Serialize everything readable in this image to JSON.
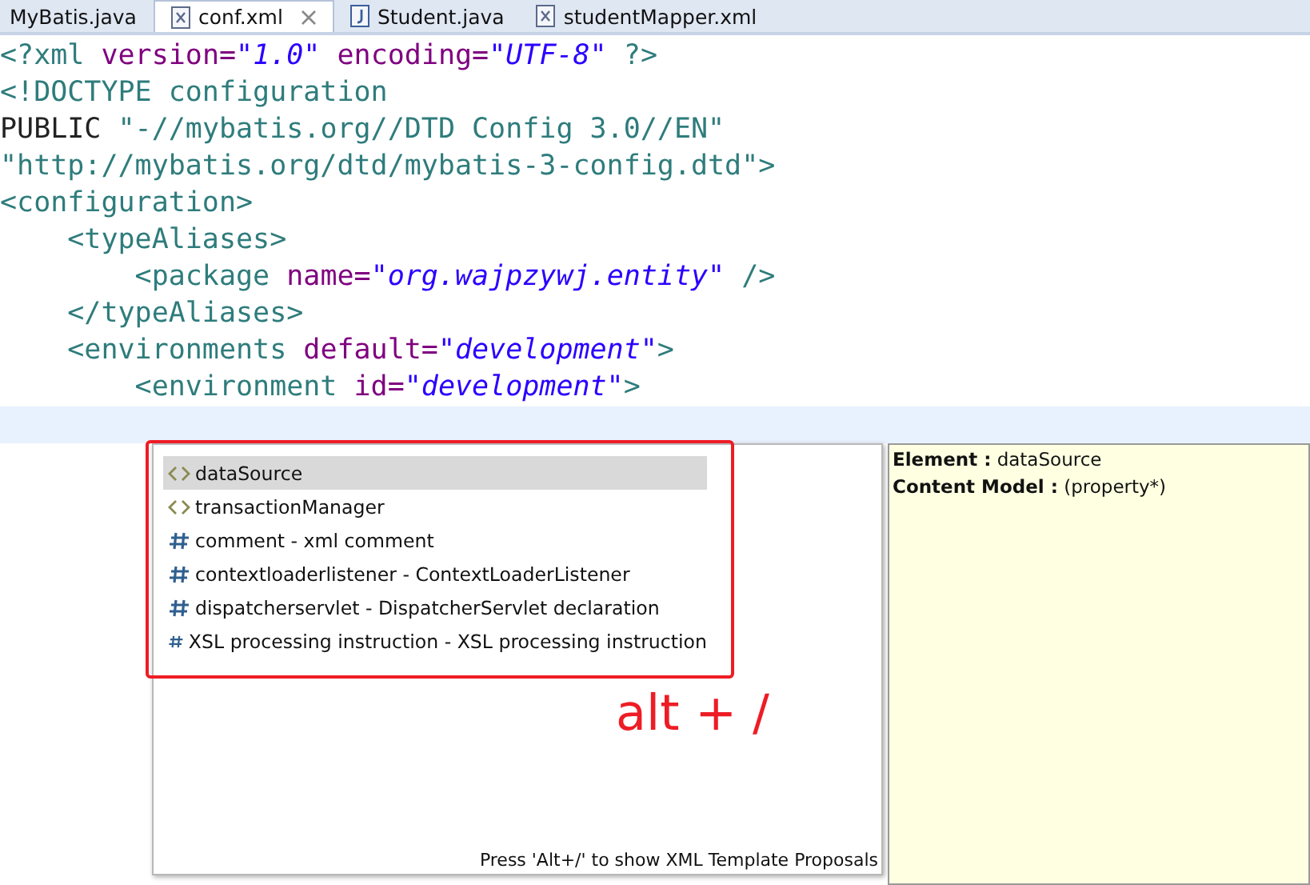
{
  "tabs": [
    {
      "label": "MyBatis.java",
      "kind": "none",
      "selected": false
    },
    {
      "label": "conf.xml",
      "kind": "xml",
      "selected": true
    },
    {
      "label": "Student.java",
      "kind": "java",
      "selected": false
    },
    {
      "label": "studentMapper.xml",
      "kind": "xml",
      "selected": false
    }
  ],
  "code": [
    {
      "kind": "tag",
      "open": "<?xml",
      "attrs": [
        {
          "name": "version=",
          "value": "\"1.0\""
        },
        {
          "name": "encoding=",
          "value": "\"UTF-8\""
        }
      ],
      "close": "?>",
      "current": false
    },
    {
      "kind": "doctype",
      "segments": [
        {
          "kind": "tag",
          "text": "<!DOCTYPE configuration"
        }
      ],
      "current": false
    },
    {
      "kind": "doctype",
      "segments": [
        {
          "kind": "keyword",
          "text": "PUBLIC"
        },
        {
          "kind": "string",
          "text": "\"-//mybatis.org//DTD Config 3.0//EN\""
        }
      ],
      "current": false
    },
    {
      "kind": "doctype",
      "segments": [
        {
          "kind": "string",
          "text": "\"http://mybatis.org/dtd/mybatis-3-config.dtd\""
        },
        {
          "kind": "tag",
          "text": ">"
        }
      ],
      "current": false
    },
    {
      "kind": "tag",
      "open": "<configuration",
      "close": ">",
      "current": false,
      "children": [
        {
          "kind": "tag",
          "open": "<typeAliases",
          "close": ">",
          "current": false,
          "children": [
            {
              "kind": "tag",
              "open": "<package",
              "attrs": [
                {
                  "name": "name=",
                  "value": "\"org.wajpzywj.entity\""
                }
              ],
              "close": "/>",
              "current": false
            }
          ]
        },
        {
          "kind": "tag",
          "open": "</typeAliases",
          "close": ">",
          "current": false
        },
        {
          "kind": "tag",
          "open": "<environments",
          "attrs": [
            {
              "name": "default=",
              "value": "\"development\""
            }
          ],
          "close": ">",
          "current": false,
          "children": [
            {
              "kind": "tag",
              "open": "<environment",
              "attrs": [
                {
                  "name": "id=",
                  "value": "\"development\""
                }
              ],
              "close": ">",
              "current": false,
              "children": [
                {
                  "current": true
                }
              ]
            }
          ]
        }
      ]
    }
  ],
  "completion": {
    "items": [
      {
        "kind": "element",
        "label": "dataSource",
        "selected": true
      },
      {
        "kind": "element",
        "label": "transactionManager",
        "selected": false
      },
      {
        "kind": "template",
        "label": "comment - xml comment",
        "selected": false
      },
      {
        "kind": "template",
        "label": "contextloaderlistener - ContextLoaderListener",
        "selected": false
      },
      {
        "kind": "template",
        "label": "dispatcherservlet - DispatcherServlet declaration",
        "selected": false
      },
      {
        "kind": "template",
        "label": "XSL processing instruction - XSL processing instruction",
        "selected": false
      }
    ],
    "hint": "Press 'Alt+/' to show XML Template Proposals"
  },
  "info": [
    {
      "label": "Element :",
      "value": "dataSource"
    },
    {
      "label": "Content Model :",
      "value": "(property*)"
    }
  ],
  "annotation": "alt + /"
}
